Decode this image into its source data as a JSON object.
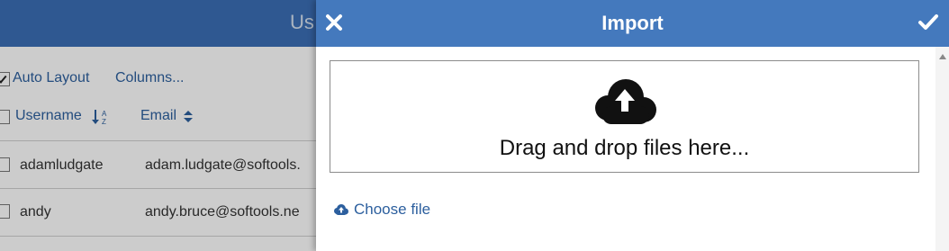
{
  "background": {
    "title_fragment": "Us",
    "toolbar": {
      "auto_layout_label": "Auto Layout",
      "auto_layout_checked": true,
      "columns_link": "Columns..."
    },
    "columns": [
      "Username",
      "Email"
    ],
    "rows": [
      {
        "username": "adamludgate",
        "email": "adam.ludgate@softools."
      },
      {
        "username": "andy",
        "email": "andy.bruce@softools.ne"
      }
    ]
  },
  "dialog": {
    "title": "Import",
    "close_icon": "close-icon",
    "confirm_icon": "check-icon",
    "dropzone_text": "Drag and drop files here...",
    "upload_icon": "cloud-upload-icon",
    "choose_file_label": "Choose file"
  },
  "colors": {
    "header": "#4479bd",
    "link": "#2c5f9e"
  }
}
